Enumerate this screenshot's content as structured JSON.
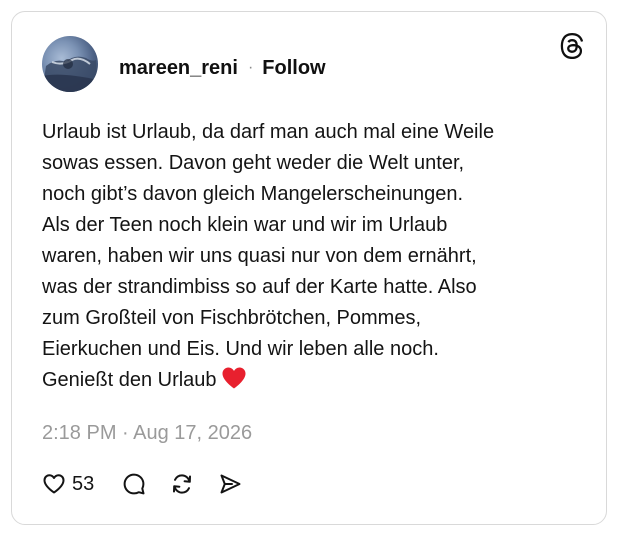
{
  "post": {
    "username": "mareen_reni",
    "separator": "·",
    "follow_label": "Follow",
    "text_lines": [
      "Urlaub ist Urlaub, da darf man auch mal eine Weile",
      "sowas essen. Davon geht weder die Welt unter,",
      "noch gibt’s davon gleich Mangelerscheinungen.",
      "Als der Teen noch klein war und wir im Urlaub",
      "waren, haben wir uns quasi nur von dem ernährt,",
      "was der strandimbiss so auf der Karte hatte. Also",
      "zum Großteil von Fischbrötchen, Pommes,",
      "Eierkuchen und Eis. Und wir leben alle noch.",
      "Genießt den Urlaub"
    ],
    "emoji": "red-heart-emoji",
    "timestamp": "2:18 PM · Aug 17, 2026"
  },
  "actions": {
    "like_count": "53",
    "icons": [
      "heart-icon",
      "comment-icon",
      "repost-icon",
      "share-icon"
    ]
  },
  "brand": {
    "logo": "threads-logo-icon"
  },
  "colors": {
    "text": "#141414",
    "muted": "#9a9a9a",
    "border": "#d9d9d9",
    "heart_emoji": "#e8202e"
  }
}
